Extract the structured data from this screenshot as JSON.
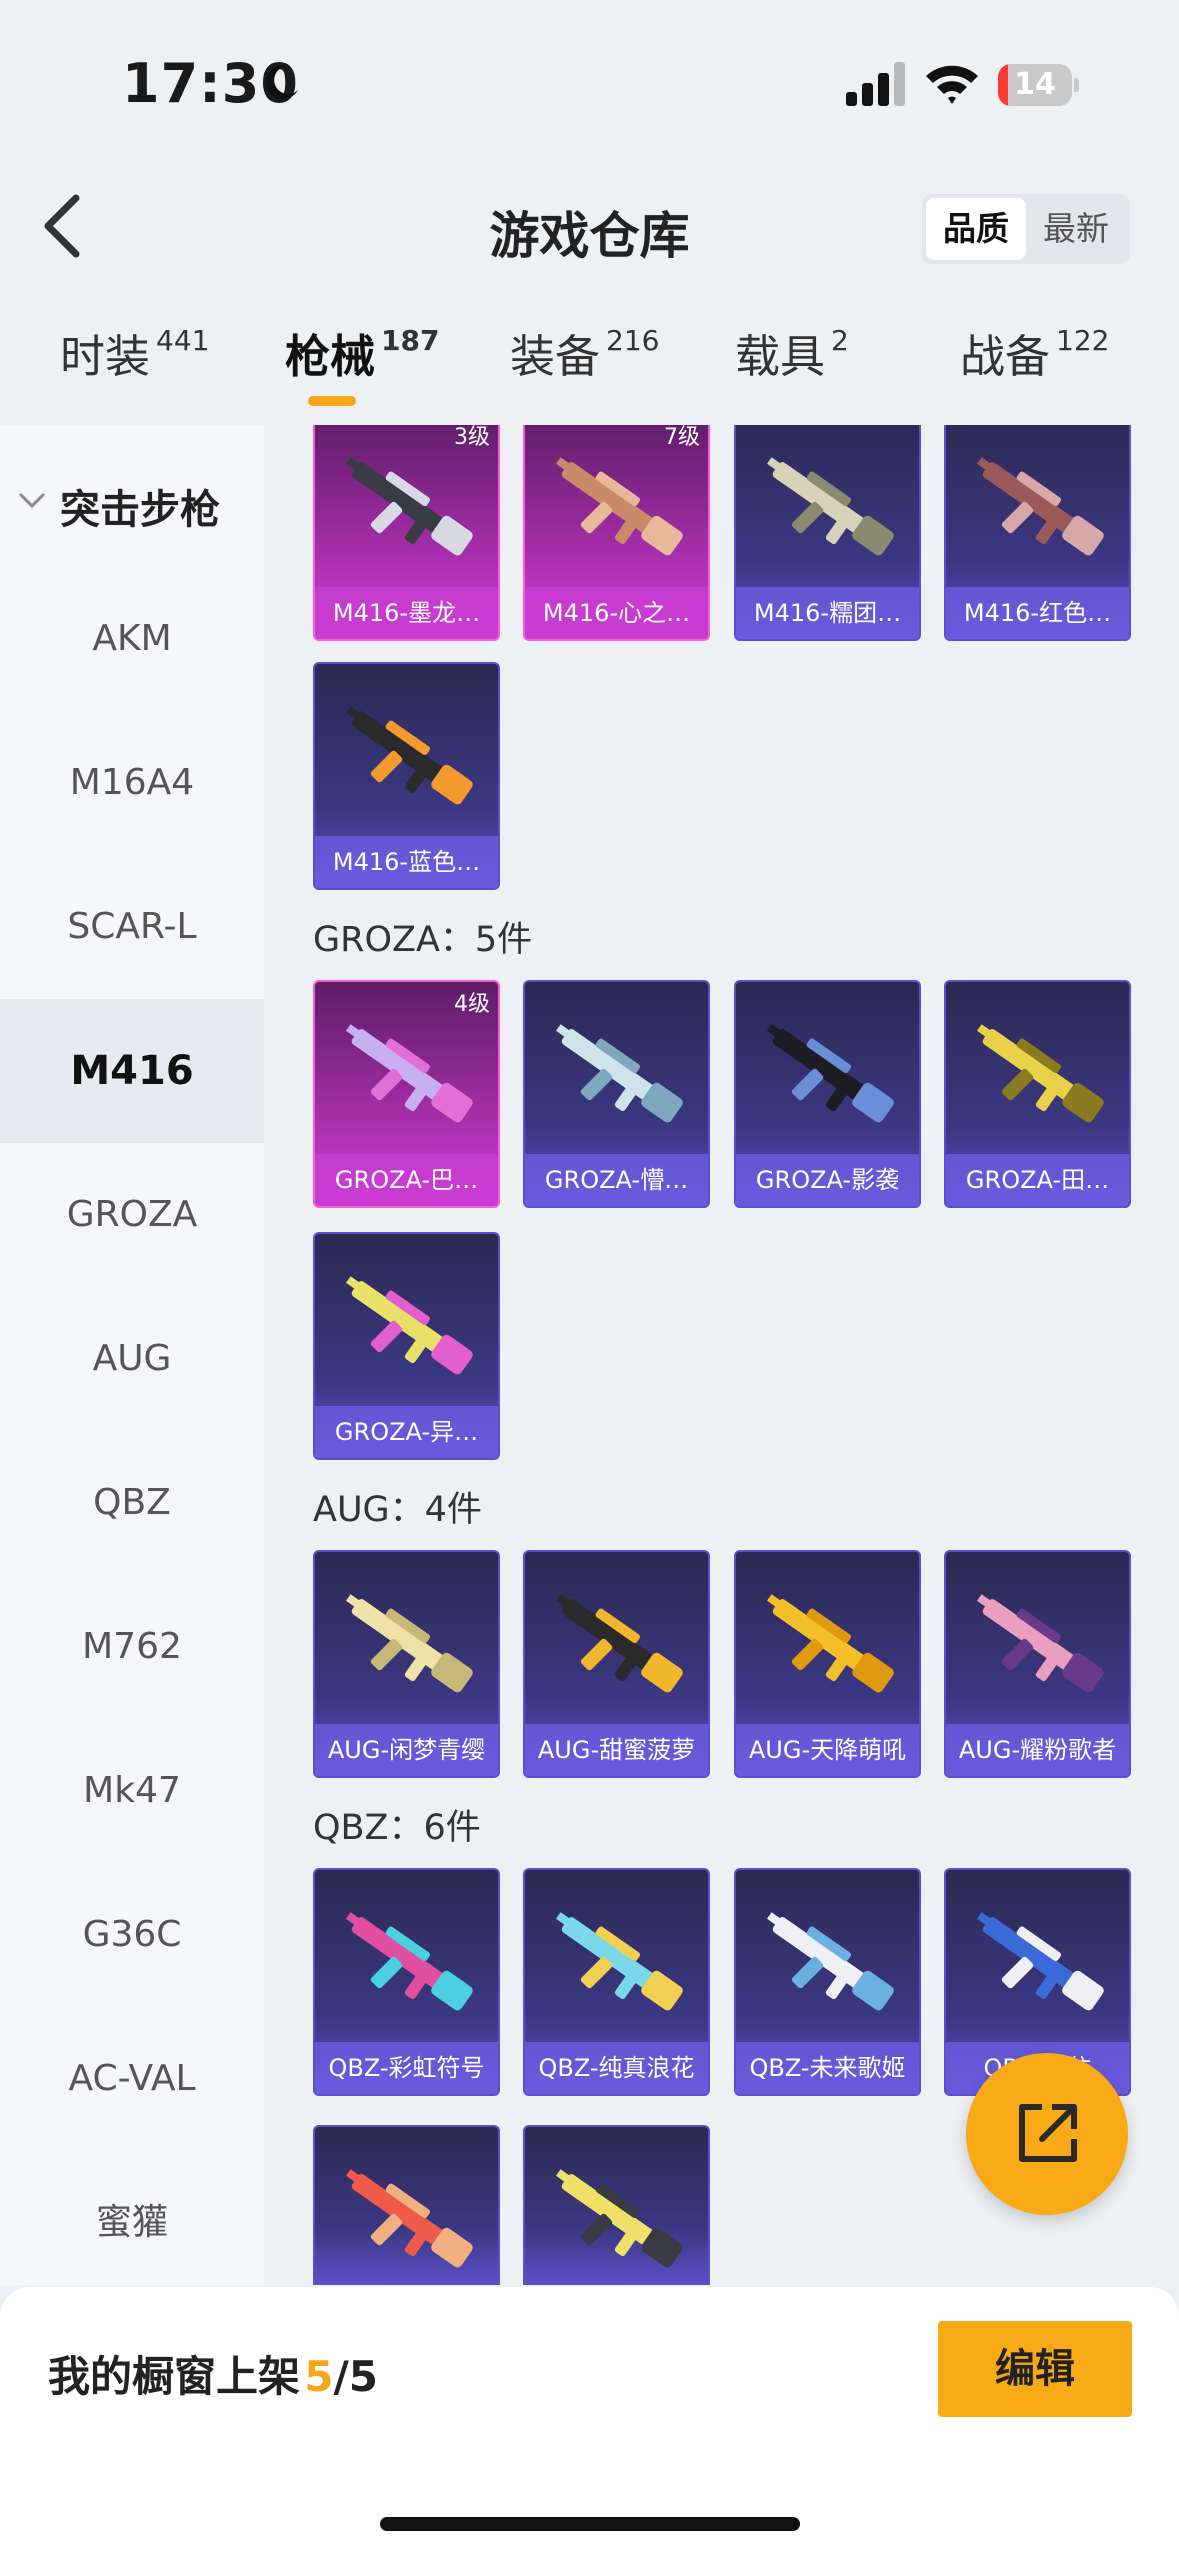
{
  "status": {
    "time": "17:30",
    "battery": "14",
    "battery_level": 0.14
  },
  "header": {
    "title": "游戏仓库",
    "sort_options": [
      "品质",
      "最新"
    ],
    "sort_selected": "品质"
  },
  "tabs": [
    {
      "label": "时装",
      "count": "441"
    },
    {
      "label": "枪械",
      "count": "187"
    },
    {
      "label": "装备",
      "count": "216"
    },
    {
      "label": "载具",
      "count": "2"
    },
    {
      "label": "战备",
      "count": "122"
    }
  ],
  "sidebar": {
    "category": "突击步枪",
    "items": [
      "AKM",
      "M16A4",
      "SCAR-L",
      "M416",
      "GROZA",
      "AUG",
      "QBZ",
      "M762",
      "Mk47",
      "G36C",
      "AC-VAL",
      "蜜獾"
    ],
    "selected": "M416"
  },
  "sections": [
    {
      "header": "",
      "items": [
        {
          "name": "M416-墨龙…",
          "level": "3级",
          "rarity": "pink"
        },
        {
          "name": "M416-心之…",
          "level": "7级",
          "rarity": "pink"
        },
        {
          "name": "M416-糯团…",
          "level": "",
          "rarity": "purple"
        },
        {
          "name": "M416-红色…",
          "level": "",
          "rarity": "purple"
        },
        {
          "name": "M416-蓝色…",
          "level": "",
          "rarity": "purple"
        }
      ]
    },
    {
      "header": "GROZA：5件",
      "items": [
        {
          "name": "GROZA-巴…",
          "level": "4级",
          "rarity": "pink"
        },
        {
          "name": "GROZA-懵…",
          "level": "",
          "rarity": "purple"
        },
        {
          "name": "GROZA-影袭",
          "level": "",
          "rarity": "purple"
        },
        {
          "name": "GROZA-田…",
          "level": "",
          "rarity": "purple"
        },
        {
          "name": "GROZA-异…",
          "level": "",
          "rarity": "purple"
        }
      ]
    },
    {
      "header": "AUG：4件",
      "items": [
        {
          "name": "AUG-闲梦青缨",
          "level": "",
          "rarity": "purple"
        },
        {
          "name": "AUG-甜蜜菠萝",
          "level": "",
          "rarity": "purple"
        },
        {
          "name": "AUG-天降萌吼",
          "level": "",
          "rarity": "purple"
        },
        {
          "name": "AUG-耀粉歌者",
          "level": "",
          "rarity": "purple"
        }
      ]
    },
    {
      "header": "QBZ：6件",
      "items": [
        {
          "name": "QBZ-彩虹符号",
          "level": "",
          "rarity": "purple"
        },
        {
          "name": "QBZ-纯真浪花",
          "level": "",
          "rarity": "purple"
        },
        {
          "name": "QBZ-未来歌姬",
          "level": "",
          "rarity": "purple"
        },
        {
          "name": "QBZ-…依",
          "level": "",
          "rarity": "purple"
        },
        {
          "name": "",
          "level": "",
          "rarity": "purple"
        },
        {
          "name": "",
          "level": "",
          "rarity": "purple"
        }
      ]
    }
  ],
  "gun_colors": [
    [
      "#3a3a44",
      "#d9d9e6"
    ],
    [
      "#c98a6a",
      "#e8b89a"
    ],
    [
      "#d8d2b8",
      "#8a8a70"
    ],
    [
      "#9b5a5a",
      "#d8a8a8"
    ],
    [
      "#2a2a2a",
      "#f29a2e"
    ],
    [
      "#c8b0f0",
      "#e26fd6"
    ],
    [
      "#cfe3ea",
      "#7fa8c0"
    ],
    [
      "#1c1c22",
      "#6a8fd8"
    ],
    [
      "#e9d24a",
      "#8a7a20"
    ],
    [
      "#e9e06a",
      "#e25fd0"
    ],
    [
      "#efe2a8",
      "#c7b878"
    ],
    [
      "#2a2a2a",
      "#f2b62e"
    ],
    [
      "#f4c02a",
      "#e09a10"
    ],
    [
      "#e9a0c0",
      "#6a3a8a"
    ],
    [
      "#e04fa0",
      "#4ad0e0"
    ],
    [
      "#7ad8e8",
      "#f0d050"
    ],
    [
      "#f0f0f4",
      "#6ab0e0"
    ],
    [
      "#3a6ad8",
      "#f0f0f4"
    ],
    [
      "#f05a4a",
      "#f0b080"
    ],
    [
      "#f0e06a",
      "#3a3a44"
    ]
  ],
  "share_button": "share",
  "bottom": {
    "label": "我的橱窗上架",
    "current": "5",
    "separator": "/",
    "total": "5",
    "edit_label": "编辑"
  }
}
